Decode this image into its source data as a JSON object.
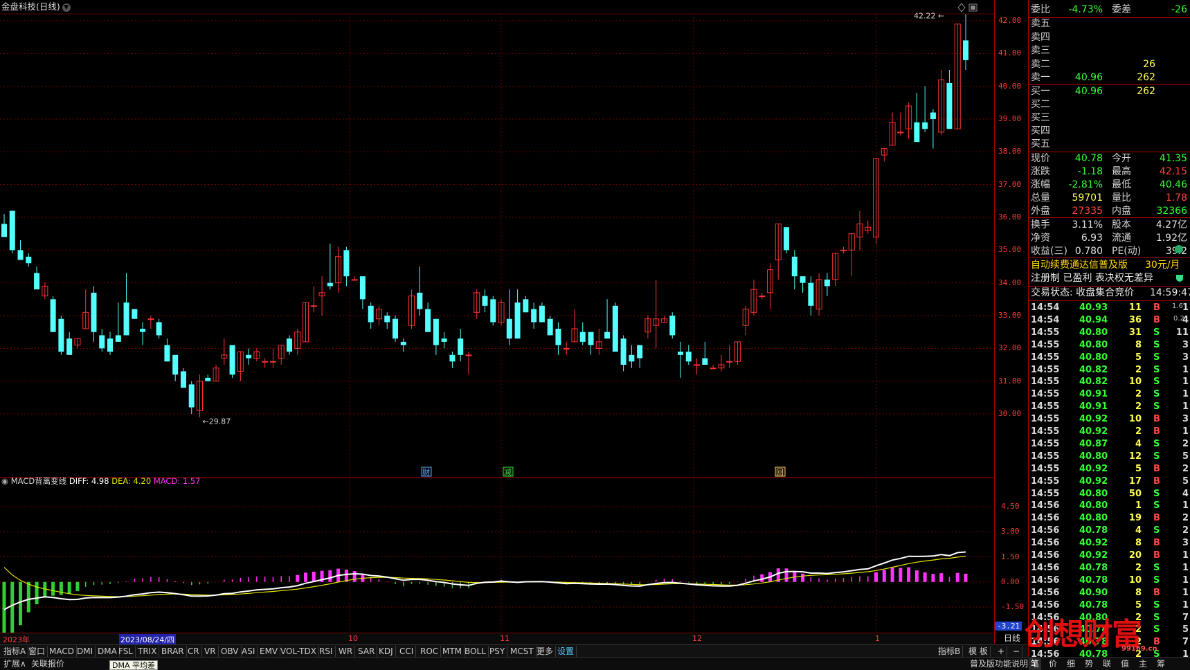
{
  "window": {
    "title": "金盘科技(日线)",
    "title_dropdown_icon": "chevron-down-icon",
    "top_right_icons": [
      "diamond-icon",
      "window-restore-icon"
    ]
  },
  "colors": {
    "up": "#ff3232",
    "down": "#54ffff",
    "grid": "#7a0000",
    "axis": "#ff3c3c",
    "diff": "#ffffff",
    "dea": "#e6e600",
    "macd_pos": "#ff33ff",
    "macd_neg": "#33cc33"
  },
  "price_axis": {
    "ticks": [
      "42.00",
      "41.00",
      "40.00",
      "39.00",
      "38.00",
      "37.00",
      "36.00",
      "35.00",
      "34.00",
      "33.00",
      "32.00",
      "31.00",
      "30.00"
    ]
  },
  "price_annotations": {
    "high": "42.22",
    "low": "29.87"
  },
  "event_markers": [
    {
      "label": "财",
      "color": "#5aa0ff"
    },
    {
      "label": "减",
      "color": "#33dd33"
    },
    {
      "label": "回",
      "color": "#ffcc66"
    }
  ],
  "macd": {
    "name": "MACD背离变线",
    "diff_label": "DIFF: 4.98",
    "dea_label": "DEA: 4.20",
    "macd_label": "MACD: 1.57",
    "axis_ticks": [
      "4.50",
      "3.00",
      "1.50",
      "0.00",
      "-1.50"
    ],
    "axis_current": "-3.21"
  },
  "date_axis": {
    "labels": [
      "2023年",
      "2023/08/24/四",
      "10",
      "11",
      "12",
      "1"
    ],
    "period_label": "日线"
  },
  "tabs": [
    "指标A",
    "窗口",
    "MACD",
    "DMI",
    "DMA",
    "FSL",
    "TRIX",
    "BRAR",
    "CR",
    "VR",
    "OBV",
    "ASI",
    "EMV",
    "VOL-TDX",
    "RSI",
    "WR",
    "SAR",
    "KDJ",
    "CCI",
    "ROC",
    "MTM",
    "BOLL",
    "PSY",
    "MCST",
    "更多",
    "设置"
  ],
  "tabs_right": [
    "指标B",
    "模 板",
    "+",
    "−"
  ],
  "bottom_left": [
    "扩展∧",
    "关联报价"
  ],
  "tooltip": "DMA 平均差",
  "bottom_right": [
    "普及版功能说明",
    "笔",
    "价",
    "细",
    "势",
    "联",
    "值",
    "主",
    "筹"
  ],
  "quote": {
    "weibi_label": "委比",
    "weibi": "-4.73%",
    "weicha_label": "委差",
    "weicha": "-26",
    "sell": [
      {
        "label": "卖五",
        "price": "",
        "vol": ""
      },
      {
        "label": "卖四",
        "price": "",
        "vol": ""
      },
      {
        "label": "卖三",
        "price": "",
        "vol": ""
      },
      {
        "label": "卖二",
        "price": "",
        "vol": "26"
      },
      {
        "label": "卖一",
        "price": "40.96",
        "vol": "262"
      }
    ],
    "buy": [
      {
        "label": "买一",
        "price": "40.96",
        "vol": "262"
      },
      {
        "label": "买二",
        "price": "",
        "vol": ""
      },
      {
        "label": "买三",
        "price": "",
        "vol": ""
      },
      {
        "label": "买四",
        "price": "",
        "vol": ""
      },
      {
        "label": "买五",
        "price": "",
        "vol": ""
      }
    ],
    "stats": [
      {
        "l1": "现价",
        "v1": "40.78",
        "c1": "#33ff33",
        "l2": "今开",
        "v2": "41.35",
        "c2": "#33ff33"
      },
      {
        "l1": "涨跌",
        "v1": "-1.18",
        "c1": "#33ff33",
        "l2": "最高",
        "v2": "42.15",
        "c2": "#ff4444"
      },
      {
        "l1": "涨幅",
        "v1": "-2.81%",
        "c1": "#33ff33",
        "l2": "最低",
        "v2": "40.46",
        "c2": "#33ff33"
      },
      {
        "l1": "总量",
        "v1": "59701",
        "c1": "#ffff55",
        "l2": "量比",
        "v2": "1.78",
        "c2": "#ff4444"
      },
      {
        "l1": "外盘",
        "v1": "27335",
        "c1": "#ff4444",
        "l2": "内盘",
        "v2": "32366",
        "c2": "#33ff33"
      }
    ],
    "stats2": [
      {
        "l1": "换手",
        "v1": "3.11%",
        "c1": "#e0e0e0",
        "l2": "股本",
        "v2": "4.27亿",
        "c2": "#e0e0e0"
      },
      {
        "l1": "净资",
        "v1": "6.93",
        "c1": "#e0e0e0",
        "l2": "流通",
        "v2": "1.92亿",
        "c2": "#e0e0e0"
      },
      {
        "l1": "收益(三)",
        "v1": "0.780",
        "c1": "#e0e0e0",
        "l2": "PE(动)",
        "v2": "39.2",
        "c2": "#e0e0e0"
      }
    ],
    "promo1": "自动续费通达信普及版",
    "promo1_price": "30元/月",
    "promo2": "注册制 已盈利 表决权无差异",
    "status": "交易状态: 收盘集合竞价",
    "status_time": "14:59:47",
    "side_values": [
      "1.6",
      "0.2"
    ]
  },
  "ticks": [
    [
      "14:54",
      "40.93",
      "11",
      "B",
      "1"
    ],
    [
      "14:54",
      "40.94",
      "36",
      "B",
      "4"
    ],
    [
      "14:55",
      "40.80",
      "31",
      "S",
      "11"
    ],
    [
      "14:55",
      "40.80",
      "8",
      "S",
      "3"
    ],
    [
      "14:55",
      "40.80",
      "5",
      "S",
      "3"
    ],
    [
      "14:55",
      "40.82",
      "2",
      "S",
      "1"
    ],
    [
      "14:55",
      "40.82",
      "10",
      "S",
      "1"
    ],
    [
      "14:55",
      "40.91",
      "2",
      "S",
      "1"
    ],
    [
      "14:55",
      "40.91",
      "2",
      "S",
      "1"
    ],
    [
      "14:55",
      "40.92",
      "10",
      "B",
      "3"
    ],
    [
      "14:55",
      "40.92",
      "2",
      "B",
      "1"
    ],
    [
      "14:55",
      "40.87",
      "4",
      "S",
      "2"
    ],
    [
      "14:55",
      "40.80",
      "12",
      "S",
      "5"
    ],
    [
      "14:55",
      "40.92",
      "5",
      "B",
      "2"
    ],
    [
      "14:55",
      "40.92",
      "17",
      "B",
      "5"
    ],
    [
      "14:55",
      "40.80",
      "50",
      "S",
      "4"
    ],
    [
      "14:56",
      "40.80",
      "1",
      "S",
      "1"
    ],
    [
      "14:56",
      "40.80",
      "19",
      "B",
      "2"
    ],
    [
      "14:56",
      "40.78",
      "4",
      "S",
      "2"
    ],
    [
      "14:56",
      "40.92",
      "8",
      "B",
      "3"
    ],
    [
      "14:56",
      "40.92",
      "20",
      "B",
      "1"
    ],
    [
      "14:56",
      "40.78",
      "2",
      "S",
      "1"
    ],
    [
      "14:56",
      "40.78",
      "10",
      "S",
      "1"
    ],
    [
      "14:56",
      "40.90",
      "8",
      "B",
      "1"
    ],
    [
      "14:56",
      "40.78",
      "5",
      "S",
      "1"
    ],
    [
      "14:56",
      "40.80",
      "2",
      "S",
      "7"
    ],
    [
      "14:56",
      "40.78",
      "2",
      "S",
      "5"
    ],
    [
      "14:56",
      "40.78",
      "2",
      "B",
      "7"
    ],
    [
      "14:56",
      "40.78",
      "2",
      "S",
      "1"
    ]
  ],
  "watermark": "创想财富",
  "watermark_url": "99169.cn",
  "chart_data": {
    "type": "candlestick",
    "title": "金盘科技(日线)",
    "ylim": [
      29.5,
      42.5
    ],
    "candles": [
      [
        35.8,
        36.1,
        35.4,
        35.4
      ],
      [
        36.2,
        36.2,
        34.9,
        35.0
      ],
      [
        35.0,
        35.3,
        34.7,
        34.7
      ],
      [
        34.8,
        34.9,
        34.5,
        34.6
      ],
      [
        34.3,
        34.5,
        33.8,
        33.8
      ],
      [
        33.6,
        34.0,
        33.5,
        33.9
      ],
      [
        33.5,
        33.6,
        32.5,
        32.5
      ],
      [
        32.9,
        33.0,
        31.8,
        31.9
      ],
      [
        32.3,
        32.5,
        31.8,
        31.8
      ],
      [
        32.1,
        32.3,
        32.0,
        32.3
      ],
      [
        32.6,
        33.8,
        32.6,
        33.1
      ],
      [
        33.7,
        33.9,
        32.2,
        32.5
      ],
      [
        32.4,
        32.6,
        31.9,
        32.0
      ],
      [
        32.3,
        32.5,
        31.8,
        31.9
      ],
      [
        32.4,
        33.4,
        32.4,
        32.2
      ],
      [
        33.4,
        34.3,
        32.4,
        32.4
      ],
      [
        33.2,
        33.2,
        32.9,
        32.9
      ],
      [
        32.6,
        32.8,
        32.1,
        32.5
      ],
      [
        32.9,
        33.0,
        32.6,
        32.9
      ],
      [
        32.8,
        32.9,
        32.3,
        32.4
      ],
      [
        32.1,
        32.3,
        31.6,
        31.6
      ],
      [
        31.8,
        31.8,
        31.0,
        31.2
      ],
      [
        31.3,
        31.4,
        30.8,
        30.8
      ],
      [
        30.9,
        31.0,
        30.0,
        30.2
      ],
      [
        30.1,
        31.2,
        29.9,
        31.0
      ],
      [
        31.1,
        31.2,
        31.0,
        31.0
      ],
      [
        31.0,
        31.5,
        31.0,
        31.4
      ],
      [
        31.7,
        32.3,
        31.5,
        31.8
      ],
      [
        32.1,
        32.1,
        31.1,
        31.2
      ],
      [
        31.3,
        31.9,
        31.0,
        31.9
      ],
      [
        31.8,
        32.0,
        31.5,
        31.7
      ],
      [
        31.7,
        32.0,
        31.6,
        31.9
      ],
      [
        31.6,
        31.7,
        31.4,
        31.6
      ],
      [
        31.6,
        32.0,
        31.4,
        31.6
      ],
      [
        31.7,
        32.1,
        31.5,
        32.1
      ],
      [
        32.3,
        32.4,
        31.8,
        31.9
      ],
      [
        32.0,
        32.6,
        31.8,
        32.5
      ],
      [
        32.2,
        33.4,
        32.2,
        33.4
      ],
      [
        33.3,
        33.9,
        33.1,
        33.3
      ],
      [
        33.6,
        34.2,
        33.0,
        33.7
      ],
      [
        34.0,
        35.2,
        33.8,
        33.9
      ],
      [
        34.0,
        35.1,
        33.7,
        34.8
      ],
      [
        35.0,
        35.1,
        33.9,
        34.2
      ],
      [
        34.1,
        34.2,
        34.1,
        34.1
      ],
      [
        34.2,
        34.2,
        33.2,
        33.5
      ],
      [
        33.3,
        33.4,
        32.6,
        32.8
      ],
      [
        32.9,
        33.3,
        32.7,
        33.2
      ],
      [
        33.0,
        33.1,
        32.6,
        32.8
      ],
      [
        32.9,
        33.0,
        32.2,
        32.3
      ],
      [
        32.2,
        32.3,
        31.9,
        32.1
      ],
      [
        32.7,
        33.8,
        32.6,
        33.6
      ],
      [
        33.7,
        34.5,
        33.0,
        33.2
      ],
      [
        33.2,
        33.4,
        32.5,
        32.5
      ],
      [
        32.9,
        32.9,
        31.8,
        32.1
      ],
      [
        32.3,
        32.5,
        32.0,
        32.2
      ],
      [
        31.8,
        31.9,
        31.4,
        31.6
      ],
      [
        32.3,
        32.6,
        31.6,
        31.8
      ],
      [
        31.8,
        31.9,
        31.2,
        31.8
      ],
      [
        33.1,
        33.8,
        32.9,
        33.7
      ],
      [
        33.6,
        33.8,
        33.1,
        33.3
      ],
      [
        33.5,
        33.6,
        32.7,
        32.8
      ],
      [
        32.8,
        33.5,
        32.7,
        33.4
      ],
      [
        32.9,
        33.8,
        32.1,
        32.3
      ],
      [
        33.4,
        33.8,
        32.3,
        32.3
      ],
      [
        33.5,
        33.6,
        33.1,
        33.1
      ],
      [
        33.2,
        33.4,
        32.6,
        32.8
      ],
      [
        33.3,
        33.4,
        32.8,
        32.8
      ],
      [
        32.9,
        33.0,
        32.4,
        32.4
      ],
      [
        32.6,
        32.8,
        31.8,
        32.1
      ],
      [
        32.0,
        32.2,
        31.8,
        32.0
      ],
      [
        32.2,
        33.2,
        32.2,
        32.6
      ],
      [
        32.5,
        32.8,
        32.1,
        32.2
      ],
      [
        32.5,
        32.5,
        31.8,
        32.1
      ],
      [
        32.0,
        32.6,
        31.8,
        32.2
      ],
      [
        32.5,
        33.5,
        32.4,
        32.3
      ],
      [
        33.3,
        33.4,
        31.9,
        31.9
      ],
      [
        32.3,
        32.4,
        31.3,
        31.5
      ],
      [
        31.8,
        32.1,
        31.4,
        31.6
      ],
      [
        32.1,
        32.1,
        31.4,
        31.7
      ],
      [
        32.5,
        33.0,
        32.3,
        32.9
      ],
      [
        32.7,
        34.1,
        32.0,
        32.9
      ],
      [
        32.8,
        33.0,
        32.9,
        32.9
      ],
      [
        33.0,
        33.1,
        32.3,
        32.4
      ],
      [
        31.9,
        32.2,
        31.1,
        31.8
      ],
      [
        31.9,
        32.1,
        31.5,
        31.6
      ],
      [
        31.5,
        31.7,
        31.2,
        31.5
      ],
      [
        31.7,
        32.2,
        31.5,
        31.5
      ],
      [
        31.4,
        31.5,
        31.4,
        31.4
      ],
      [
        31.4,
        31.8,
        31.3,
        31.5
      ],
      [
        31.6,
        32.1,
        31.4,
        31.6
      ],
      [
        31.6,
        32.2,
        31.5,
        32.2
      ],
      [
        32.7,
        33.3,
        32.4,
        33.2
      ],
      [
        33.1,
        34.1,
        33.0,
        33.8
      ],
      [
        33.6,
        33.7,
        33.5,
        33.6
      ],
      [
        33.7,
        34.6,
        33.2,
        34.4
      ],
      [
        34.7,
        35.6,
        34.1,
        35.8
      ],
      [
        35.7,
        35.6,
        34.9,
        35.0
      ],
      [
        34.8,
        35.0,
        33.8,
        34.2
      ],
      [
        34.2,
        34.2,
        33.7,
        34.0
      ],
      [
        34.0,
        34.2,
        33.0,
        33.3
      ],
      [
        33.2,
        34.3,
        33.0,
        34.1
      ],
      [
        34.1,
        34.3,
        33.6,
        33.9
      ],
      [
        34.1,
        34.6,
        33.9,
        34.9
      ],
      [
        35.0,
        35.1,
        34.9,
        35.0
      ],
      [
        35.0,
        35.4,
        34.2,
        35.5
      ],
      [
        35.4,
        36.2,
        35.0,
        35.8
      ],
      [
        35.6,
        35.9,
        35.5,
        35.7
      ],
      [
        35.4,
        36.5,
        35.2,
        37.8
      ],
      [
        37.9,
        38.1,
        37.7,
        38.1
      ],
      [
        38.2,
        39.2,
        38.3,
        38.9
      ],
      [
        38.6,
        39.2,
        38.5,
        38.6
      ],
      [
        38.7,
        39.5,
        38.4,
        39.4
      ],
      [
        38.9,
        39.8,
        38.7,
        38.3
      ],
      [
        38.9,
        40.0,
        38.6,
        38.7
      ],
      [
        39.2,
        39.3,
        38.1,
        39.0
      ],
      [
        38.6,
        40.5,
        38.5,
        40.2
      ],
      [
        40.1,
        40.5,
        39.1,
        38.7
      ],
      [
        38.7,
        40.1,
        38.7,
        41.9
      ],
      [
        41.4,
        42.2,
        40.5,
        40.8
      ]
    ],
    "macd": {
      "diff": 4.98,
      "dea": 4.2,
      "macd": 1.57
    },
    "xlabels": [
      "2023年",
      "2023/08/24/四",
      "10",
      "11",
      "12",
      "1"
    ]
  }
}
